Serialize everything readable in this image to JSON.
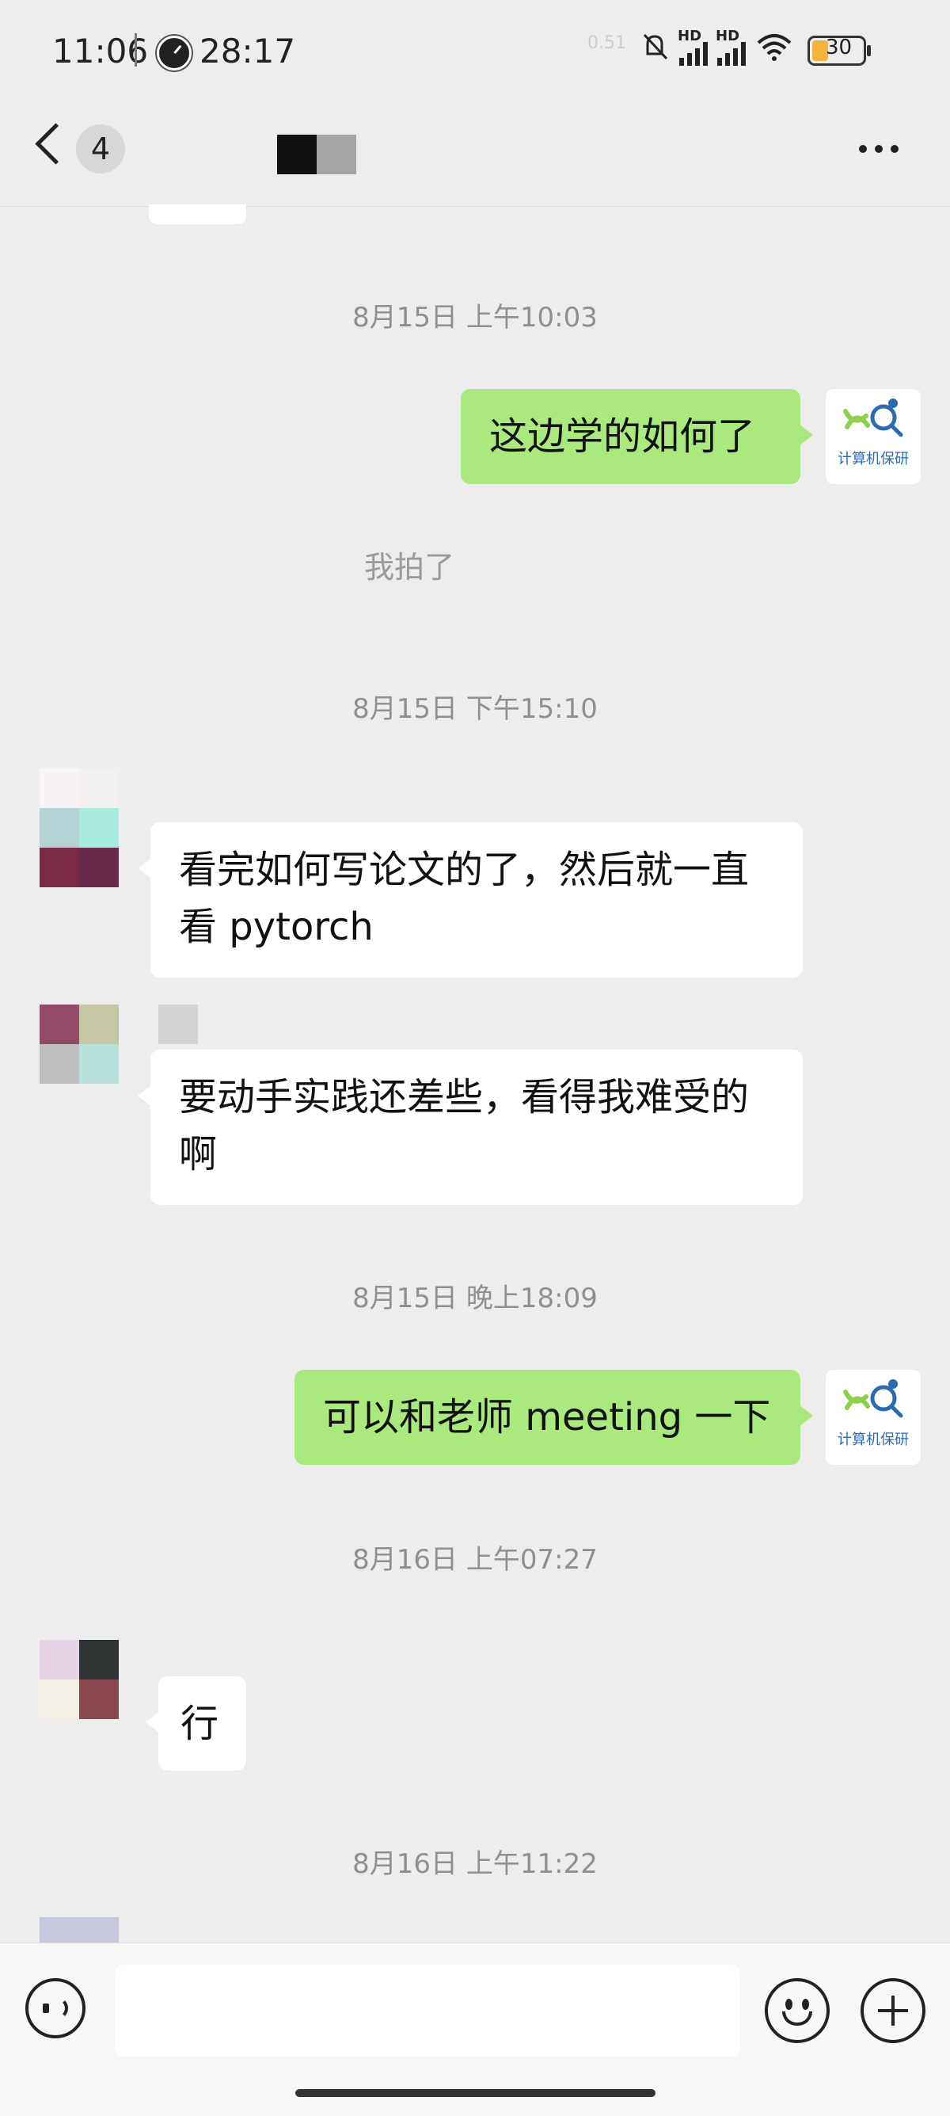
{
  "status_bar": {
    "time": "11:06",
    "timer": "28:17",
    "network_speed": "0.51",
    "battery": "30",
    "signal_label": "HD",
    "sim2_index": "6"
  },
  "nav": {
    "unread_count": "4"
  },
  "messages": {
    "ts1": "8月15日 上午10:03",
    "out1": "这边学的如何了",
    "note1": "我拍了",
    "ts2": "8月15日 下午15:10",
    "in1": "看完如何写论文的了，然后就一直看 pytorch",
    "in2": "要动手实践还差些，看得我难受的啊",
    "ts3": "8月15日 晚上18:09",
    "out2": "可以和老师 meeting 一下",
    "ts4": "8月16日 上午07:27",
    "in3": "行",
    "ts5": "8月16日 上午11:22"
  },
  "brand_avatar": {
    "name": "计算机保研",
    "accent_green": "#a9e97e",
    "logo_green": "#8fd14f",
    "logo_blue": "#2d6bb0"
  },
  "input": {
    "placeholder": ""
  },
  "colors": {
    "background": "#ededed",
    "outgoing_bubble": "#a9e97e",
    "incoming_bubble": "#ffffff",
    "timestamp_text": "#8f8f8f"
  }
}
